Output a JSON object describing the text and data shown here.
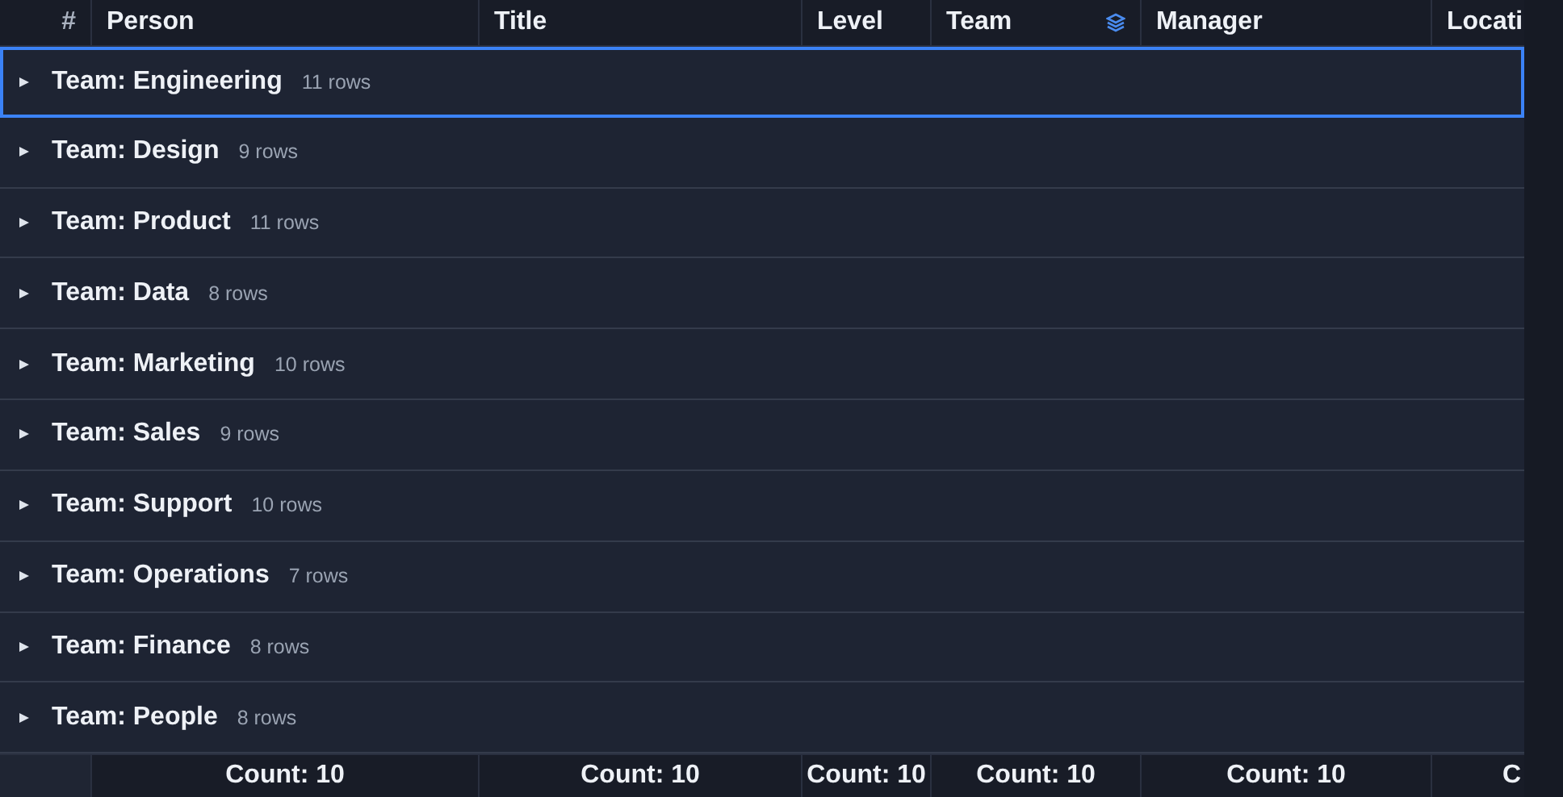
{
  "table": {
    "columns": [
      {
        "label": "#"
      },
      {
        "label": "Person"
      },
      {
        "label": "Title"
      },
      {
        "label": "Level"
      },
      {
        "label": "Team",
        "grouped": true
      },
      {
        "label": "Manager"
      },
      {
        "label": "Locati"
      }
    ],
    "groups": [
      {
        "label": "Team: Engineering",
        "count": "11 rows",
        "selected": true
      },
      {
        "label": "Team: Design",
        "count": "9 rows",
        "selected": false
      },
      {
        "label": "Team: Product",
        "count": "11 rows",
        "selected": false
      },
      {
        "label": "Team: Data",
        "count": "8 rows",
        "selected": false
      },
      {
        "label": "Team: Marketing",
        "count": "10 rows",
        "selected": false
      },
      {
        "label": "Team: Sales",
        "count": "9 rows",
        "selected": false
      },
      {
        "label": "Team: Support",
        "count": "10 rows",
        "selected": false
      },
      {
        "label": "Team: Operations",
        "count": "7 rows",
        "selected": false
      },
      {
        "label": "Team: Finance",
        "count": "8 rows",
        "selected": false
      },
      {
        "label": "Team: People",
        "count": "8 rows",
        "selected": false
      }
    ],
    "footer": [
      "Count: 10",
      "Count: 10",
      "Count: 10",
      "Count: 10",
      "Count: 10",
      "C"
    ]
  }
}
